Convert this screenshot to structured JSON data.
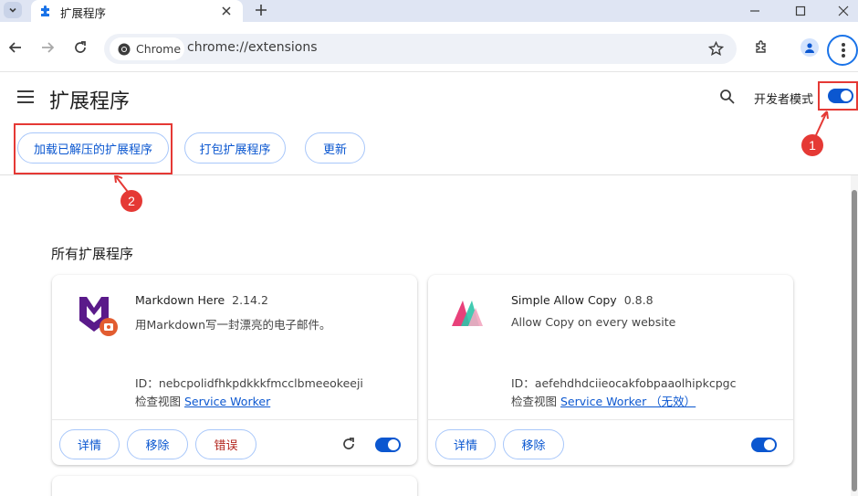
{
  "tab": {
    "title": "扩展程序"
  },
  "toolbar": {
    "chip_label": "Chrome",
    "url": "chrome://extensions"
  },
  "header": {
    "title": "扩展程序",
    "dev_mode_label": "开发者模式",
    "dev_mode_on": true,
    "buttons": {
      "load_unpacked": "加载已解压的扩展程序",
      "pack": "打包扩展程序",
      "update": "更新"
    }
  },
  "annotations": [
    "1",
    "2"
  ],
  "section_title": "所有扩展程序",
  "extensions": [
    {
      "name": "Markdown Here",
      "version": "2.14.2",
      "description": "用Markdown写一封漂亮的电子邮件。",
      "id_label": "ID：",
      "id": "nebcpolidfhkpdkkkfmcclbmeeokeeji",
      "inspect_label": "检查视图",
      "inspect_link": "Service Worker",
      "details": "详情",
      "remove": "移除",
      "errors": "错误",
      "enabled": true
    },
    {
      "name": "Simple Allow Copy",
      "version": "0.8.8",
      "description": "Allow Copy on every website",
      "id_label": "ID：",
      "id": "aefehdhdciieocakfobpaaolhipkcpgc",
      "inspect_label": "检查视图",
      "inspect_link": "Service Worker （无效）",
      "details": "详情",
      "remove": "移除",
      "enabled": true
    }
  ],
  "colors": {
    "accent": "#0b57d0",
    "annotation": "#e53935",
    "error": "#b3261e"
  },
  "icons": [
    "puzzle-icon",
    "close-icon",
    "plus-icon",
    "back-icon",
    "forward-icon",
    "reload-icon",
    "star-icon",
    "extensions-icon",
    "profile-icon",
    "menu-icon",
    "search-icon",
    "hamburger-icon"
  ]
}
